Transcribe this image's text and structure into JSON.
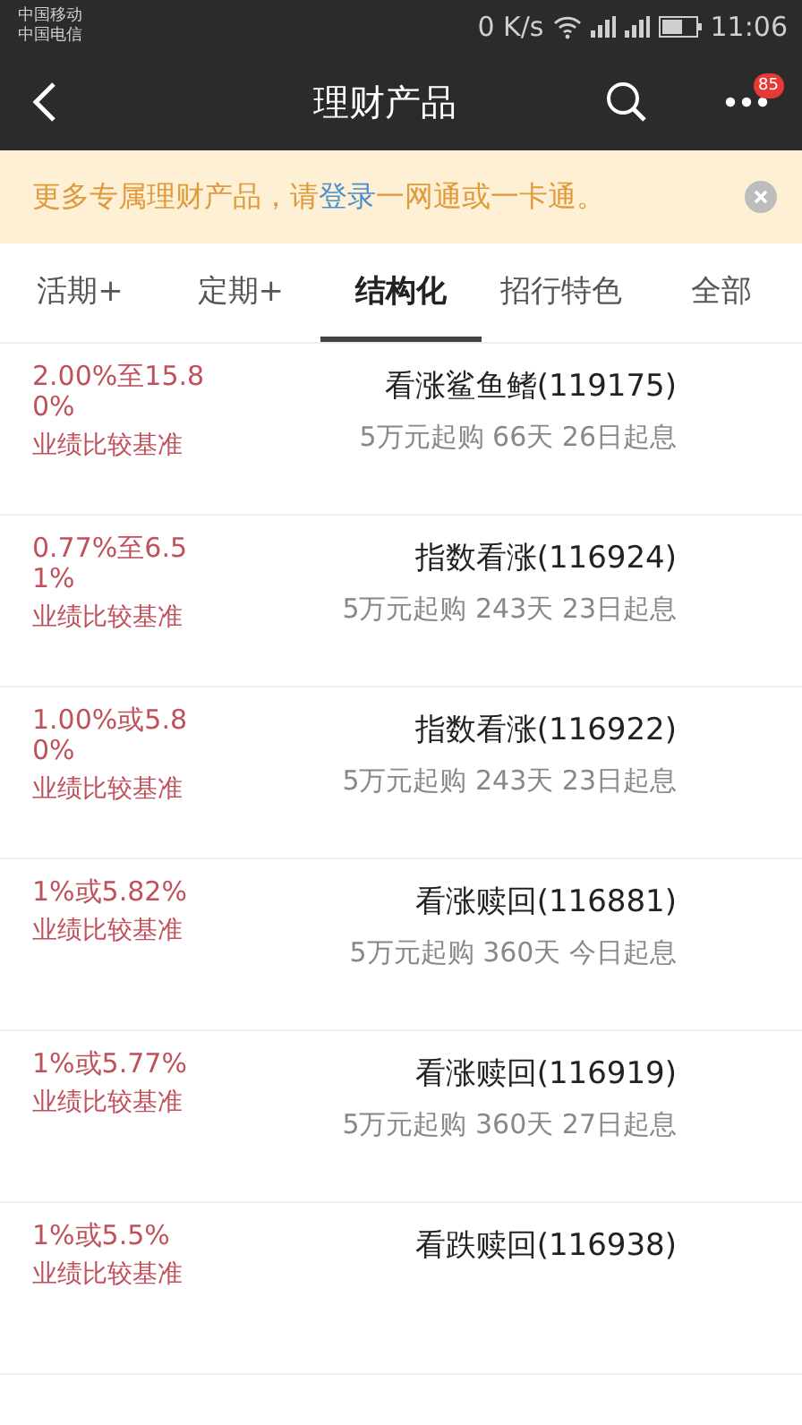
{
  "status_bar": {
    "carriers": [
      "中国移动",
      "中国电信"
    ],
    "speed": "0 K/s",
    "time": "11:06"
  },
  "header": {
    "title": "理财产品",
    "badge": "85"
  },
  "banner": {
    "text_before": "更多专属理财产品，请",
    "link": "登录",
    "text_after": "一网通或一卡通。"
  },
  "tabs": [
    {
      "label": "活期+",
      "selected": false
    },
    {
      "label": "定期+",
      "selected": false
    },
    {
      "label": "结构化",
      "selected": true
    },
    {
      "label": "招行特色",
      "selected": false
    },
    {
      "label": "全部",
      "selected": false
    }
  ],
  "products": [
    {
      "rate": "2.00%至15.80%",
      "rate_label": "业绩比较基准",
      "name": "看涨鲨鱼鳍(119175)",
      "details": "5万元起购 66天 26日起息"
    },
    {
      "rate": "0.77%至6.51%",
      "rate_label": "业绩比较基准",
      "name": "指数看涨(116924)",
      "details": "5万元起购 243天 23日起息"
    },
    {
      "rate": "1.00%或5.80%",
      "rate_label": "业绩比较基准",
      "name": "指数看涨(116922)",
      "details": "5万元起购 243天 23日起息"
    },
    {
      "rate": "1%或5.82%",
      "rate_label": "业绩比较基准",
      "name": "看涨赎回(116881)",
      "details": "5万元起购 360天 今日起息"
    },
    {
      "rate": "1%或5.77%",
      "rate_label": "业绩比较基准",
      "name": "看涨赎回(116919)",
      "details": "5万元起购 360天 27日起息"
    },
    {
      "rate": "1%或5.5%",
      "rate_label": "业绩比较基准",
      "name": "看跌赎回(116938)"
    }
  ]
}
